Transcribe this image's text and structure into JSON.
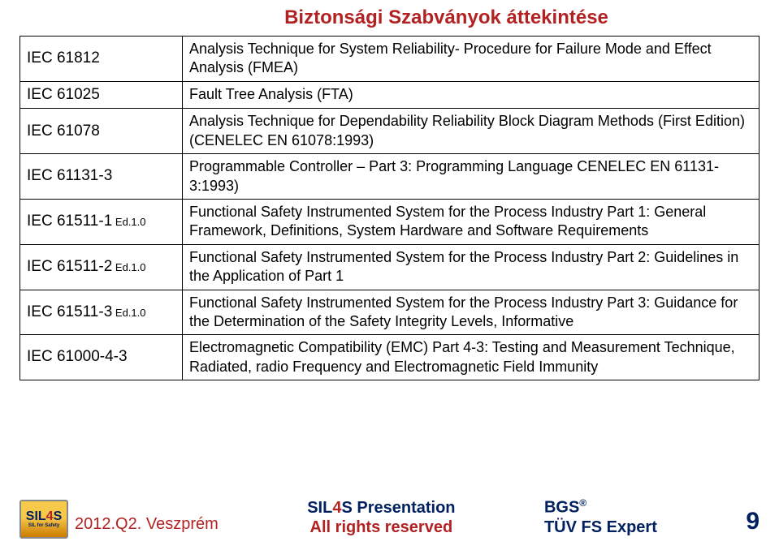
{
  "title": "Biztonsági Szabványok áttekintése",
  "rows": [
    {
      "code": "IEC 61812",
      "ed": "",
      "desc": "Analysis Technique for System Reliability- Procedure for Failure Mode and Effect Analysis (FMEA)"
    },
    {
      "code": "IEC 61025",
      "ed": "",
      "desc": "Fault Tree Analysis (FTA)"
    },
    {
      "code": "IEC 61078",
      "ed": "",
      "desc": "Analysis Technique for Dependability Reliability Block Diagram Methods (First Edition) (CENELEC EN 61078:1993)"
    },
    {
      "code": "IEC 61131-3",
      "ed": "",
      "desc": "Programmable Controller – Part 3: Programming Language CENELEC EN 61131-3:1993)"
    },
    {
      "code": "IEC 61511-1",
      "ed": " Ed.1.0",
      "desc": "Functional Safety Instrumented System for the Process Industry Part 1: General Framework, Definitions, System Hardware and Software Requirements"
    },
    {
      "code": "IEC 61511-2",
      "ed": " Ed.1.0",
      "desc": "Functional Safety Instrumented System for the Process Industry Part 2: Guidelines in the Application of Part 1"
    },
    {
      "code": "IEC 61511-3",
      "ed": " Ed.1.0",
      "desc": "Functional Safety Instrumented System for the Process Industry Part 3: Guidance for the Determination of the Safety Integrity Levels, Informative"
    },
    {
      "code": "IEC 61000-4-3",
      "ed": "",
      "desc": "Electromagnetic Compatibility (EMC) Part 4-3: Testing and Measurement Technique, Radiated, radio Frequency and Electromagnetic Field Immunity"
    }
  ],
  "logo": {
    "top": "SIL",
    "four": "4",
    "s": "S",
    "sub": "SIL for Safety"
  },
  "footer": {
    "date": "2012.Q2. Veszprém",
    "center_l1_a": "SIL",
    "center_l1_b": "4",
    "center_l1_c": "S Presentation",
    "center_l2": "All rights reserved",
    "right_l1a": "BGS",
    "right_l1b": "®",
    "right_l2": "TÜV FS Expert",
    "page": "9"
  }
}
